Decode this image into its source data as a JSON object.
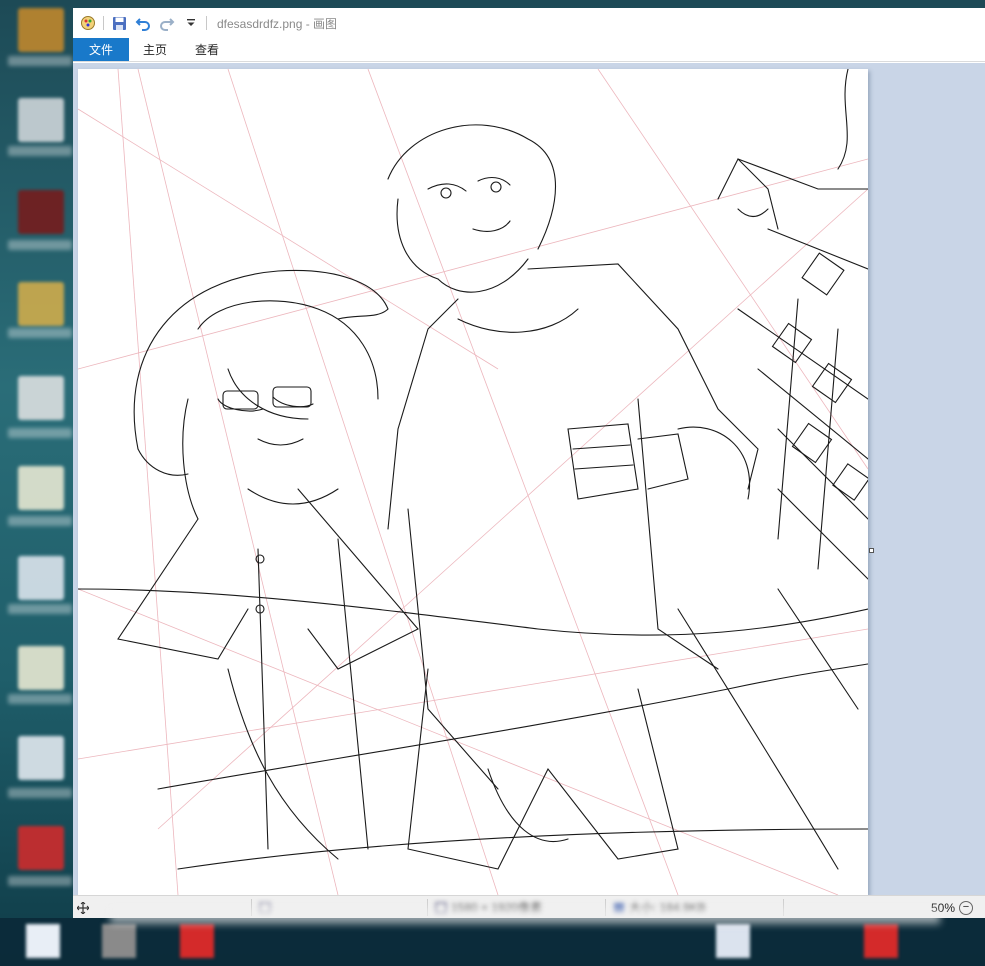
{
  "window": {
    "title": "dfesasdrdfz.png - 画图",
    "tabs": [
      "文件",
      "主页",
      "查看"
    ]
  },
  "statusbar": {
    "dimensions": "1580 × 1920像素",
    "filesize": "大小: 184.9KB",
    "zoom": "50%"
  },
  "colors": {
    "file_tab": "#1979ca",
    "workarea": "#c9d5e7",
    "desktop": "#1f5e6a"
  }
}
